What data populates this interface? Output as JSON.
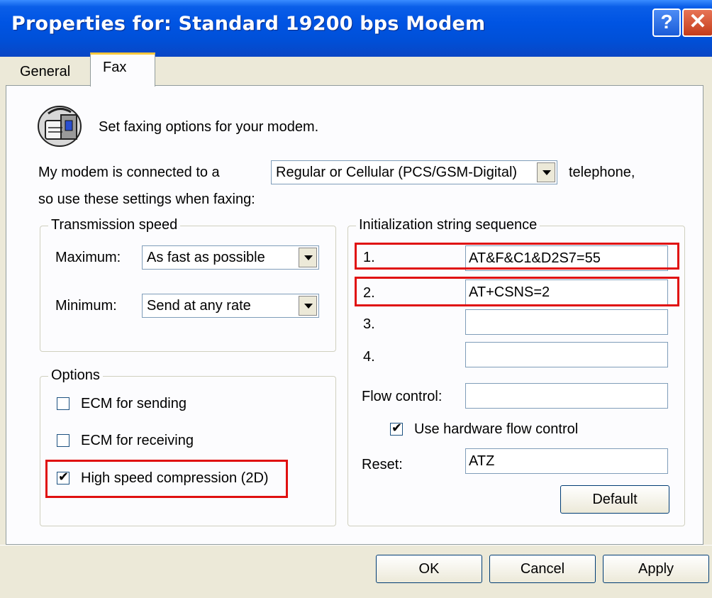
{
  "window": {
    "title": "Properties for: Standard 19200 bps Modem",
    "help_glyph": "?",
    "close_glyph": "✕"
  },
  "tabs": [
    {
      "label": "General"
    },
    {
      "label": "Fax"
    }
  ],
  "fax": {
    "intro": "Set faxing options for your modem.",
    "connected_prefix": "My modem is connected to a",
    "connection_type": "Regular or Cellular (PCS/GSM-Digital)",
    "connected_suffix": "telephone,",
    "settings_note": "so use these settings when faxing:"
  },
  "transmission": {
    "title": "Transmission speed",
    "max_label": "Maximum:",
    "max_value": "As fast as possible",
    "min_label": "Minimum:",
    "min_value": "Send at any rate"
  },
  "options": {
    "title": "Options",
    "ecm_send": "ECM for sending",
    "ecm_send_checked": false,
    "ecm_receive": "ECM for receiving",
    "ecm_receive_checked": false,
    "high_speed": "High speed compression (2D)",
    "high_speed_checked": true
  },
  "init": {
    "title": "Initialization string sequence",
    "rows": [
      {
        "label": "1.",
        "value": "AT&F&C1&D2S7=55"
      },
      {
        "label": "2.",
        "value": "AT+CSNS=2"
      },
      {
        "label": "3.",
        "value": ""
      },
      {
        "label": "4.",
        "value": ""
      }
    ],
    "flow_label": "Flow control:",
    "flow_value": "",
    "hw_flow": "Use hardware flow control",
    "hw_flow_checked": true,
    "reset_label": "Reset:",
    "reset_value": "ATZ",
    "default_button": "Default"
  },
  "buttons": {
    "ok": "OK",
    "cancel": "Cancel",
    "apply": "Apply"
  },
  "colors": {
    "title_bar": "#0054e3",
    "highlight": "#e01010",
    "dialog_bg": "#ece9d8",
    "panel_bg": "#fcfcfe"
  }
}
